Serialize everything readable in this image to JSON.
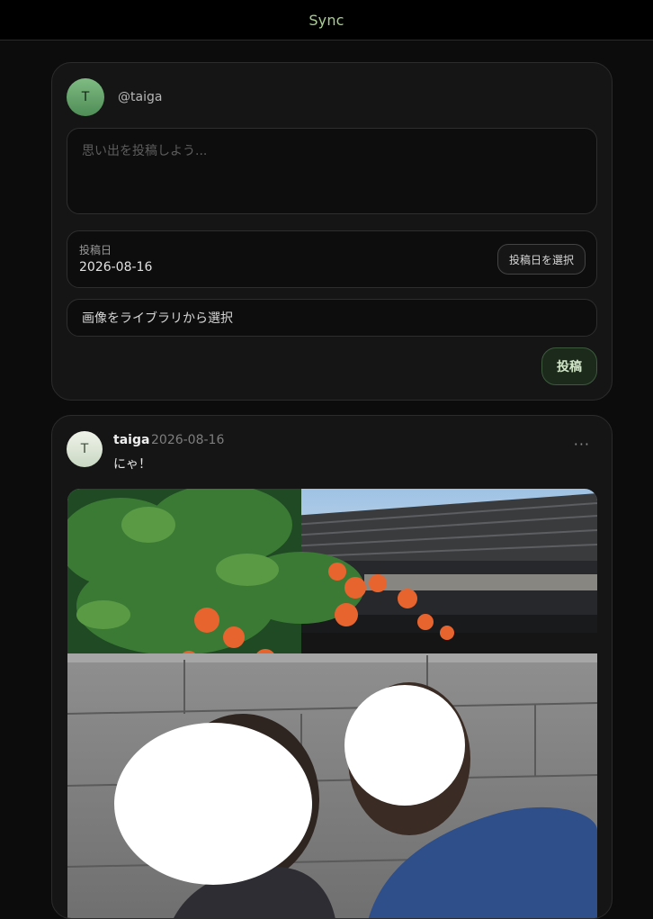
{
  "app": {
    "title": "Sync"
  },
  "composer": {
    "avatar_initial": "T",
    "handle": "@taiga",
    "placeholder": "思い出を投稿しよう...",
    "date_label": "投稿日",
    "date_value": "2026-08-16",
    "date_button": "投稿日を選択",
    "image_select_label": "画像をライブラリから選択",
    "post_button": "投稿"
  },
  "post": {
    "avatar_initial": "T",
    "username": "taiga",
    "date": "2026-08-16",
    "text": "にゃ！",
    "more_label": "···"
  }
}
